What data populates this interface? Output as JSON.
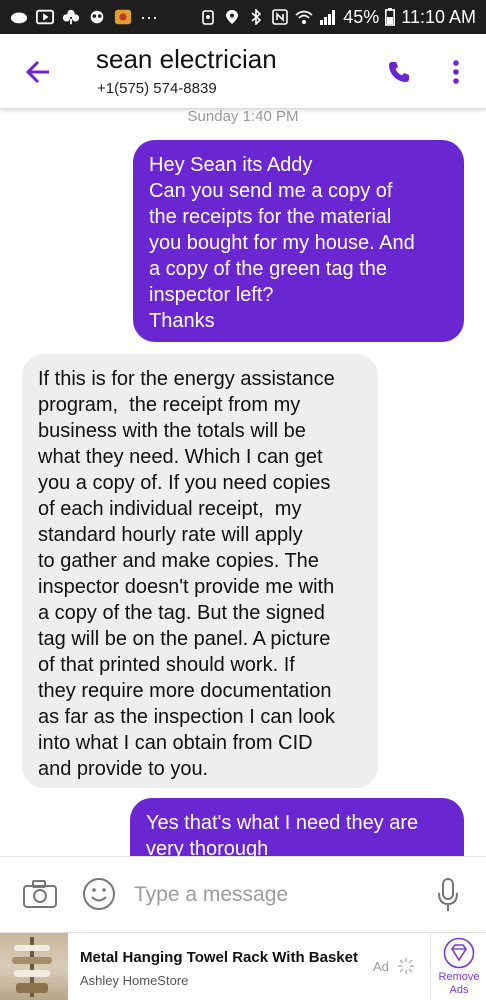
{
  "status_bar": {
    "battery": "45%",
    "time": "11:10 AM",
    "icons": [
      "cloud-icon",
      "play-icon",
      "clover-icon",
      "game-icon",
      "app-icon",
      "ellipsis-icon",
      "alarm-icon",
      "location-icon",
      "bluetooth-icon",
      "nfc-icon",
      "wifi-icon",
      "signal-icon",
      "battery-icon"
    ]
  },
  "header": {
    "contact_name": "sean electrician",
    "contact_phone": "+1(575) 574-8839",
    "accent_color": "#6a26d1"
  },
  "conversation": {
    "date_label": "Sunday 1:40 PM",
    "messages": [
      {
        "direction": "sent",
        "text": "Hey Sean its Addy\nCan you send me a copy of\nthe receipts for the material\nyou bought for my house. And\na copy of the green tag the\ninspector left?\nThanks"
      },
      {
        "direction": "received",
        "text": "If this is for the energy assistance\nprogram,  the receipt from my\nbusiness with the totals will be\nwhat they need. Which I can get\nyou a copy of. If you need copies\nof each individual receipt,  my\nstandard hourly rate will apply\nto gather and make copies. The\ninspector doesn't provide me with\na copy of the tag. But the signed\ntag will be on the panel. A picture\nof that printed should work. If\nthey require more documentation\nas far as the inspection I can look\ninto what I can obtain from CID\nand provide to you."
      },
      {
        "direction": "sent",
        "text": "Yes that's what I need they are\nvery thorough"
      }
    ],
    "sent_bubble_color": "#6a26d1",
    "received_bubble_color": "#eeeeee"
  },
  "compose": {
    "placeholder": "Type a message"
  },
  "ad": {
    "title": "Metal Hanging Towel Rack With Basket",
    "source": "Ashley HomeStore",
    "badge": "Ad",
    "remove_label": "Remove\nAds"
  }
}
